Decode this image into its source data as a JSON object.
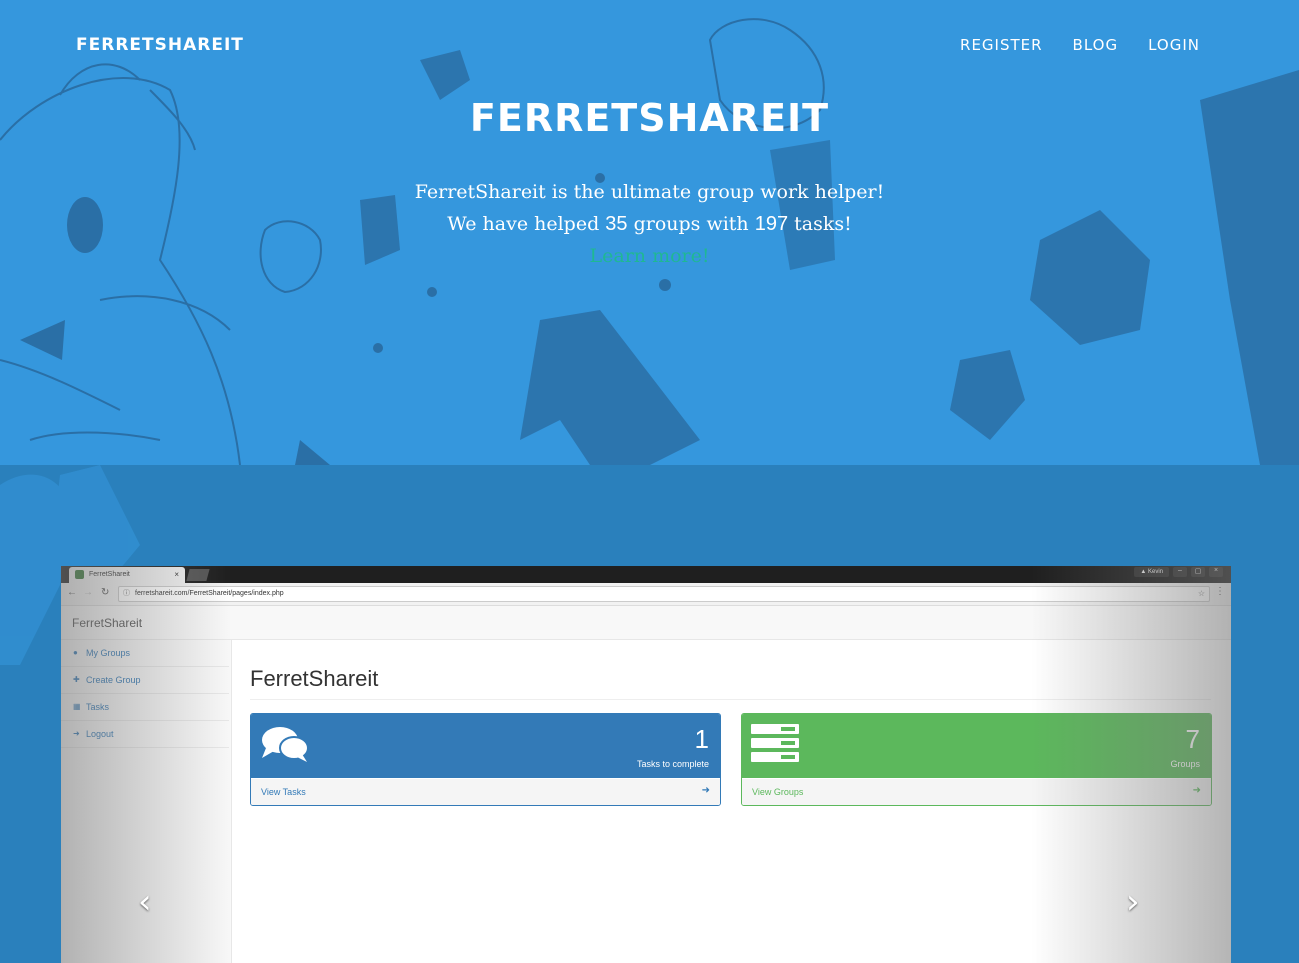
{
  "nav": {
    "brand": "FERRETSHAREIT",
    "links": [
      "REGISTER",
      "BLOG",
      "LOGIN"
    ]
  },
  "hero": {
    "title": "FERRETSHAREIT",
    "line1": "FerretShareit is the ultimate group work helper!",
    "line2_before": "We have helped ",
    "groups_count": "35",
    "line2_mid": " groups with ",
    "tasks_count": "197",
    "line2_after": " tasks!",
    "learn_more": "Learn more!",
    "learn_more_color": "#1fb893",
    "background_color": "#3597dd"
  },
  "screenshot": {
    "browser": {
      "tab_title": "FerretShareit",
      "tab_close": "×",
      "user": "Kevin",
      "url": "ferretshareit.com/FerretShareit/pages/index.php",
      "window_buttons": [
        "–",
        "▢",
        "×"
      ]
    },
    "app": {
      "brand": "FerretShareit",
      "sidebar": [
        {
          "icon": "users-icon",
          "label": "My Groups"
        },
        {
          "icon": "plus-icon",
          "label": "Create Group"
        },
        {
          "icon": "table-icon",
          "label": "Tasks"
        },
        {
          "icon": "sign-out-icon",
          "label": "Logout"
        }
      ],
      "heading": "FerretShareit",
      "panels": [
        {
          "icon": "comments-icon",
          "count": "1",
          "subtitle": "Tasks to complete",
          "link": "View Tasks",
          "color": "#337ab7"
        },
        {
          "icon": "server-icon",
          "count": "7",
          "subtitle": "Groups",
          "link": "View Groups",
          "color": "#5cb85c"
        }
      ]
    }
  },
  "carousel": {
    "prev": "‹",
    "next": "›"
  }
}
